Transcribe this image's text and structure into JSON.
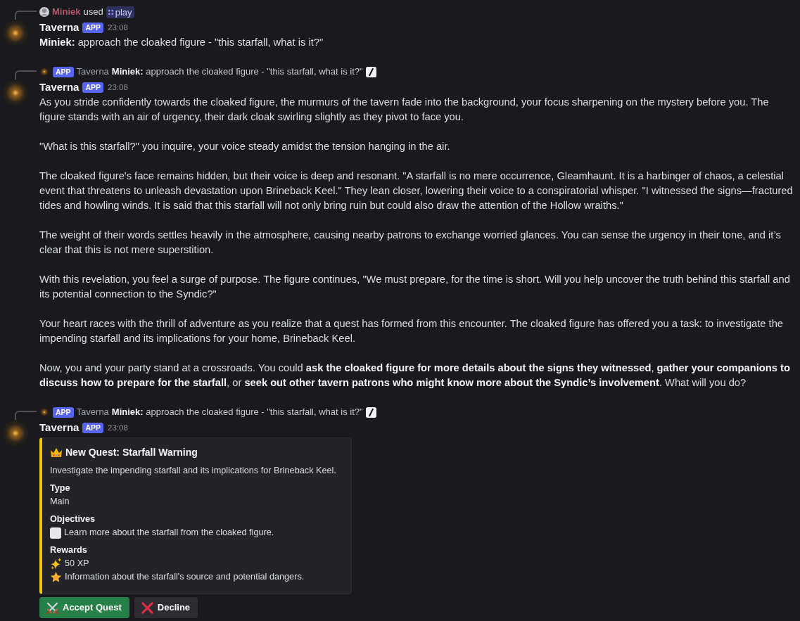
{
  "messages": [
    {
      "header": {
        "kind": "command",
        "user": "Miniek",
        "verb": "used",
        "command": "play"
      },
      "author": "Taverna",
      "badge": "APP",
      "time": "23:08",
      "paragraphs": [
        "**Miniek:** approach the cloaked figure - \"this starfall, what is it?\""
      ]
    },
    {
      "header": {
        "kind": "reply",
        "badge": "APP",
        "author": "Taverna",
        "text": "**Miniek:** approach the cloaked figure - \"this starfall, what is it?\""
      },
      "author": "Taverna",
      "badge": "APP",
      "time": "23:08",
      "paragraphs": [
        "As you stride confidently towards the cloaked figure, the murmurs of the tavern fade into the background, your focus sharpening on the mystery before you. The figure stands with an air of urgency, their dark cloak swirling slightly as they pivot to face you.",
        "\"What is this starfall?\" you inquire, your voice steady amidst the tension hanging in the air.",
        "The cloaked figure's face remains hidden, but their voice is deep and resonant. \"A starfall is no mere occurrence, Gleamhaunt. It is a harbinger of chaos, a celestial event that threatens to unleash devastation upon Brineback Keel.\" They lean closer, lowering their voice to a conspiratorial whisper. \"I witnessed the signs—fractured tides and howling winds. It is said that this starfall will not only bring ruin but could also draw the attention of the Hollow wraiths.\"",
        "The weight of their words settles heavily in the atmosphere, causing nearby patrons to exchange worried glances. You can sense the urgency in their tone, and it’s clear that this is not mere superstition.",
        "With this revelation, you feel a surge of purpose. The figure continues, \"We must prepare, for the time is short. Will you help uncover the truth behind this starfall and its potential connection to the Syndic?\"",
        "Your heart races with the thrill of adventure as you realize that a quest has formed from this encounter. The cloaked figure has offered you a task: to investigate the impending starfall and its implications for your home, Brineback Keel.",
        "Now, you and your party stand at a crossroads. You could **ask the cloaked figure for more details about the signs they witnessed**, **gather your companions to discuss how to prepare for the starfall**, or **seek out other tavern patrons who might know more about the Syndic’s involvement**. What will you do?"
      ]
    },
    {
      "header": {
        "kind": "reply",
        "badge": "APP",
        "author": "Taverna",
        "text": "**Miniek:** approach the cloaked figure - \"this starfall, what is it?\""
      },
      "author": "Taverna",
      "badge": "APP",
      "time": "23:08",
      "embed": {
        "title": "New Quest: Starfall Warning",
        "description": "Investigate the impending starfall and its implications for Brineback Keel.",
        "fields": [
          {
            "name": "Type",
            "kind": "text",
            "value": "Main"
          },
          {
            "name": "Objectives",
            "kind": "checklist",
            "items": [
              {
                "text": "Learn more about the starfall from the cloaked figure.",
                "checked": false
              }
            ]
          },
          {
            "name": "Rewards",
            "kind": "rewards",
            "items": [
              {
                "kind": "xp",
                "text": "50 XP"
              },
              {
                "kind": "item",
                "text": "Information about the starfall's source and potential dangers."
              }
            ]
          }
        ]
      },
      "buttons": [
        {
          "kind": "accept",
          "label": "Accept Quest"
        },
        {
          "kind": "decline",
          "label": "Decline"
        }
      ]
    }
  ]
}
